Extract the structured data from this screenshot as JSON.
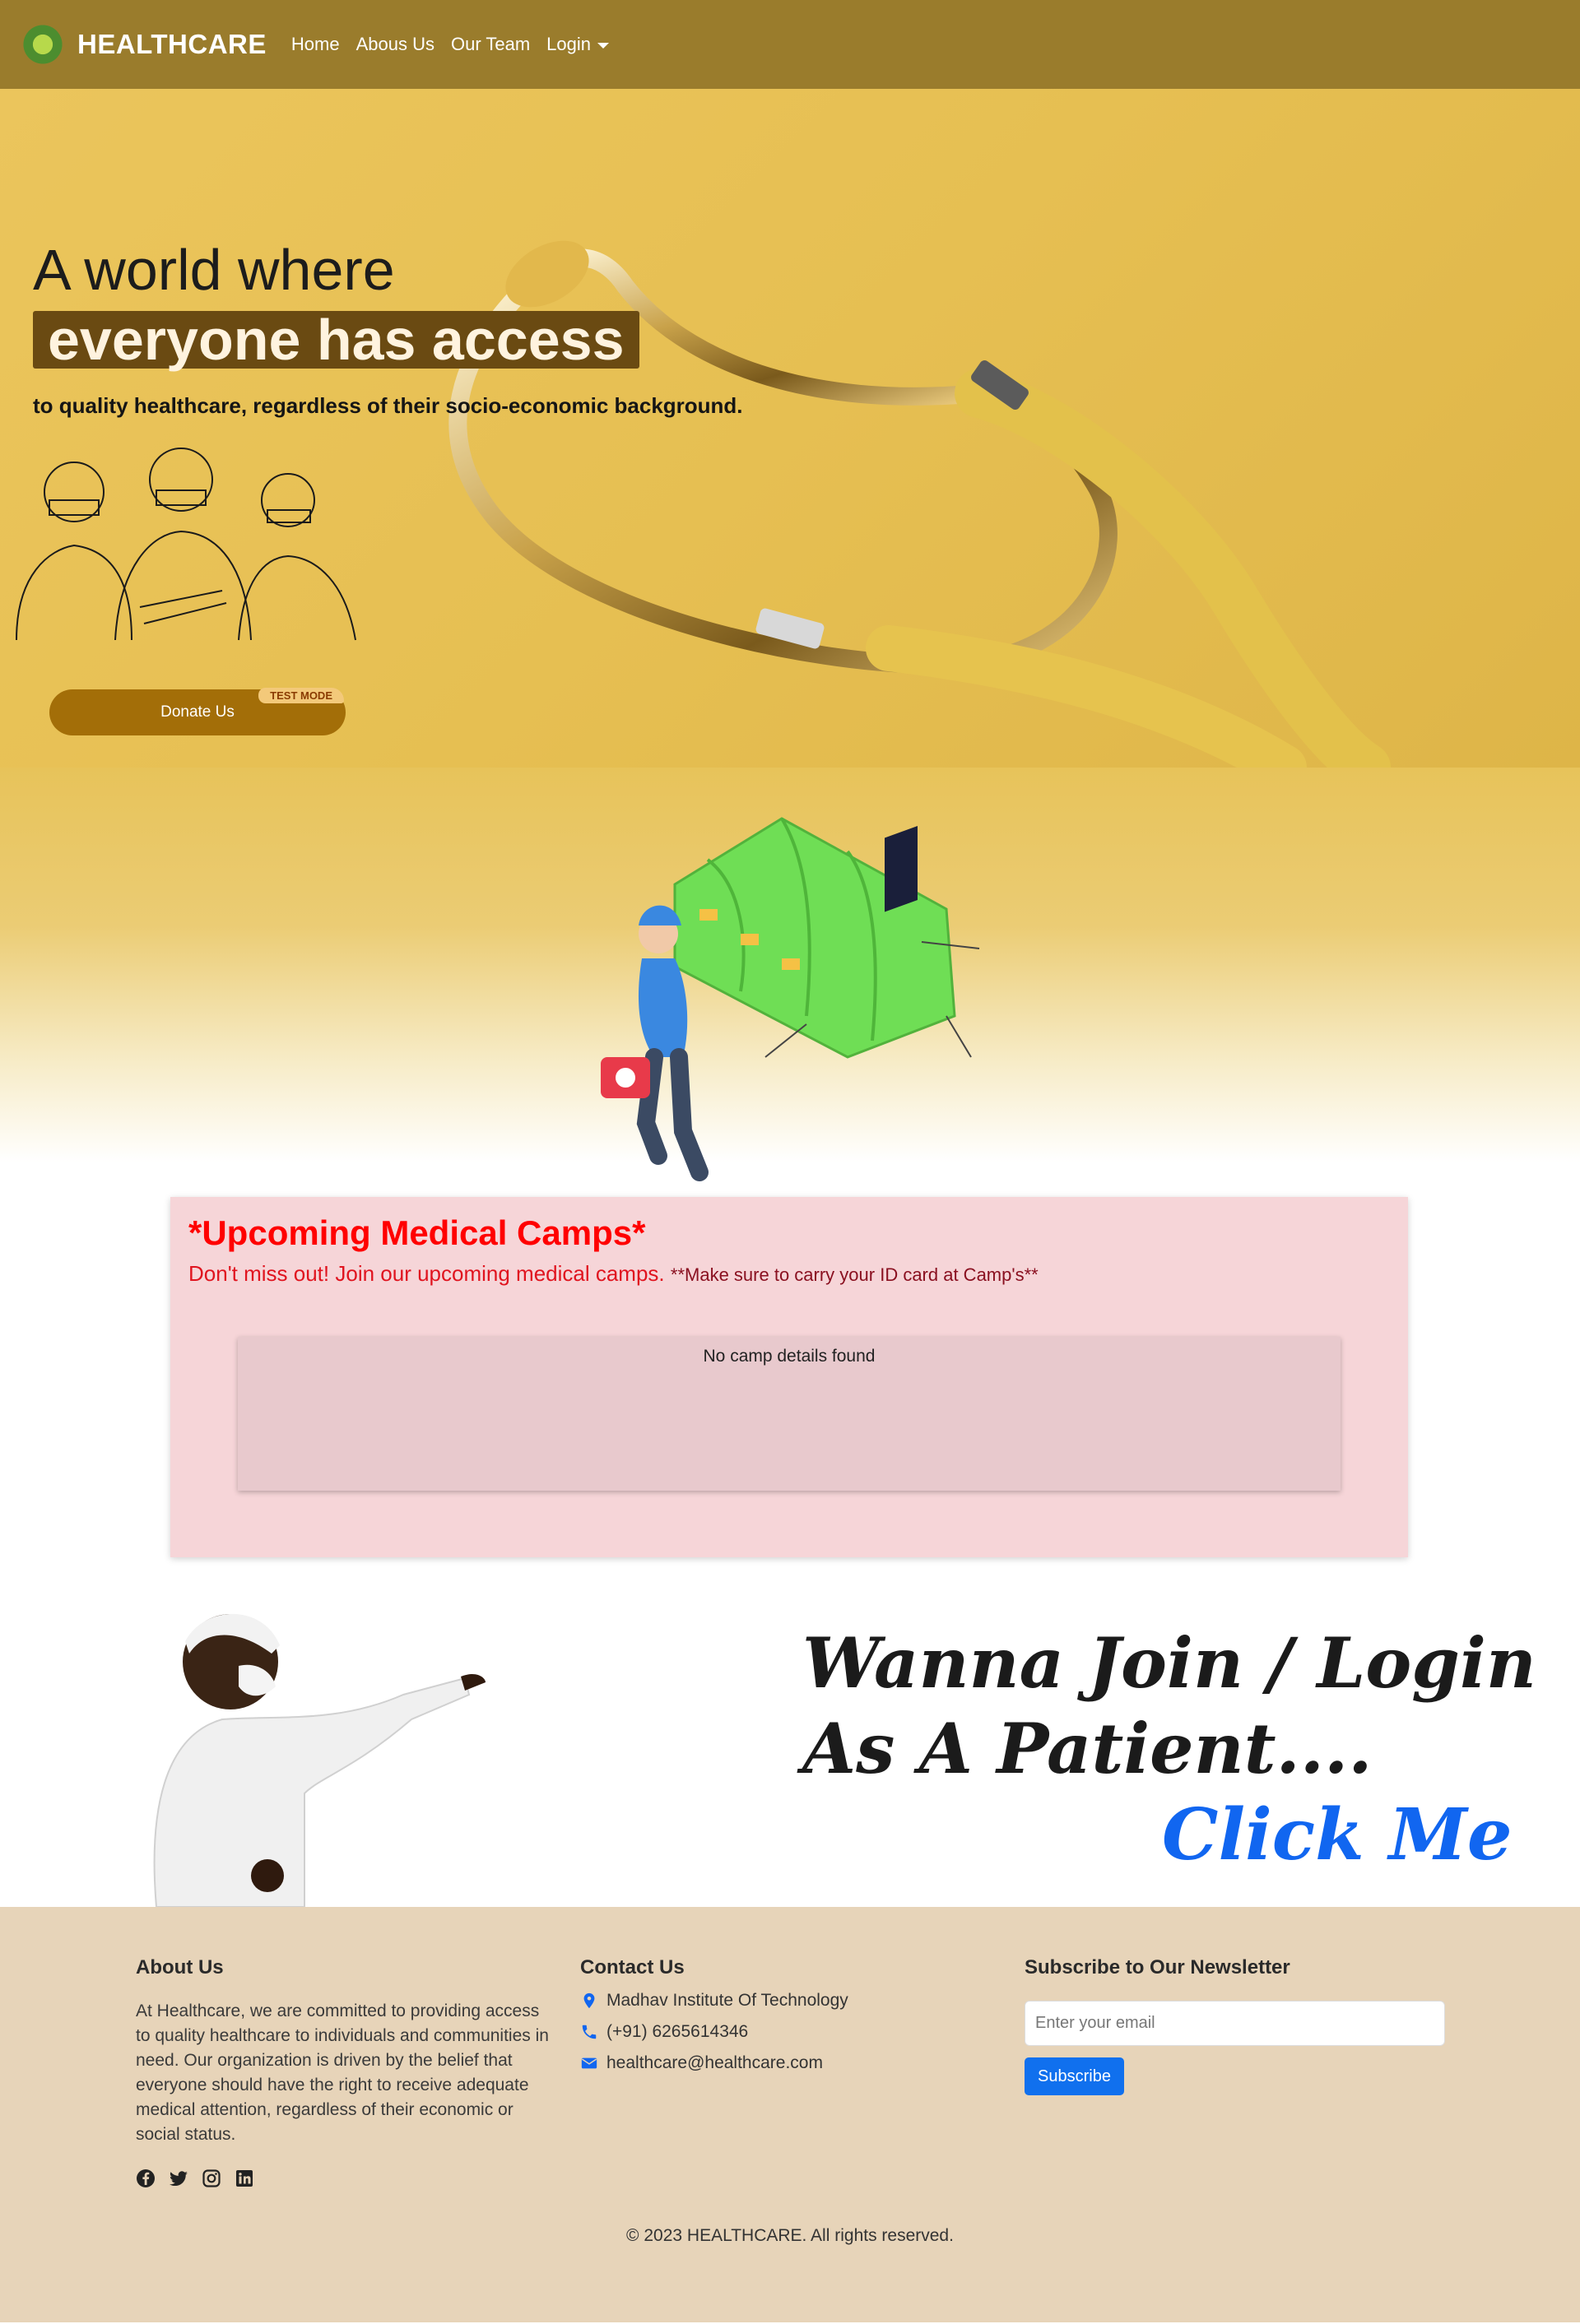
{
  "navbar": {
    "logo_icon": "caduceus-logo-icon",
    "brand": "HEALTHCARE",
    "links": [
      "Home",
      "Abous Us",
      "Our Team",
      "Login"
    ]
  },
  "hero": {
    "line1": "A world where",
    "line2": "everyone has access",
    "subtitle": "to quality healthcare, regardless of their socio-economic background.",
    "donate_label": "Donate Us",
    "badge": "TEST MODE"
  },
  "camps": {
    "title": "*Upcoming Medical Camps*",
    "subtitle": "Don't miss out! Join our upcoming medical camps. ",
    "note": "**Make sure to carry your ID card at Camp's**",
    "empty_text": "No camp details found"
  },
  "join": {
    "line1": "Wanna Join / Login",
    "line2": "As A Patient....",
    "cta": "Click Me"
  },
  "footer": {
    "about_title": "About Us",
    "about_text": "At Healthcare, we are committed to providing access to quality healthcare to individuals and communities in need. Our organization is driven by the belief that everyone should have the right to receive adequate medical attention, regardless of their economic or social status.",
    "social_icons": [
      "facebook-icon",
      "twitter-icon",
      "instagram-icon",
      "linkedin-icon"
    ],
    "contact_title": "Contact Us",
    "address": "Madhav Institute Of Technology",
    "phone": "(+91) 6265614346",
    "email": "healthcare@healthcare.com",
    "newsletter_title": "Subscribe to Our Newsletter",
    "email_placeholder": "Enter your email",
    "subscribe_label": "Subscribe",
    "copyright": "© 2023 HEALTHCARE. All rights reserved."
  },
  "colors": {
    "navbar": "#9a7c2c",
    "hero_bg": "#e6bf52",
    "donate_button": "#a36e08",
    "camps_bg": "#f6d5d8",
    "camps_title": "#ff0000",
    "cta_blue": "#1166f0",
    "footer_bg": "#e7d4b9"
  }
}
